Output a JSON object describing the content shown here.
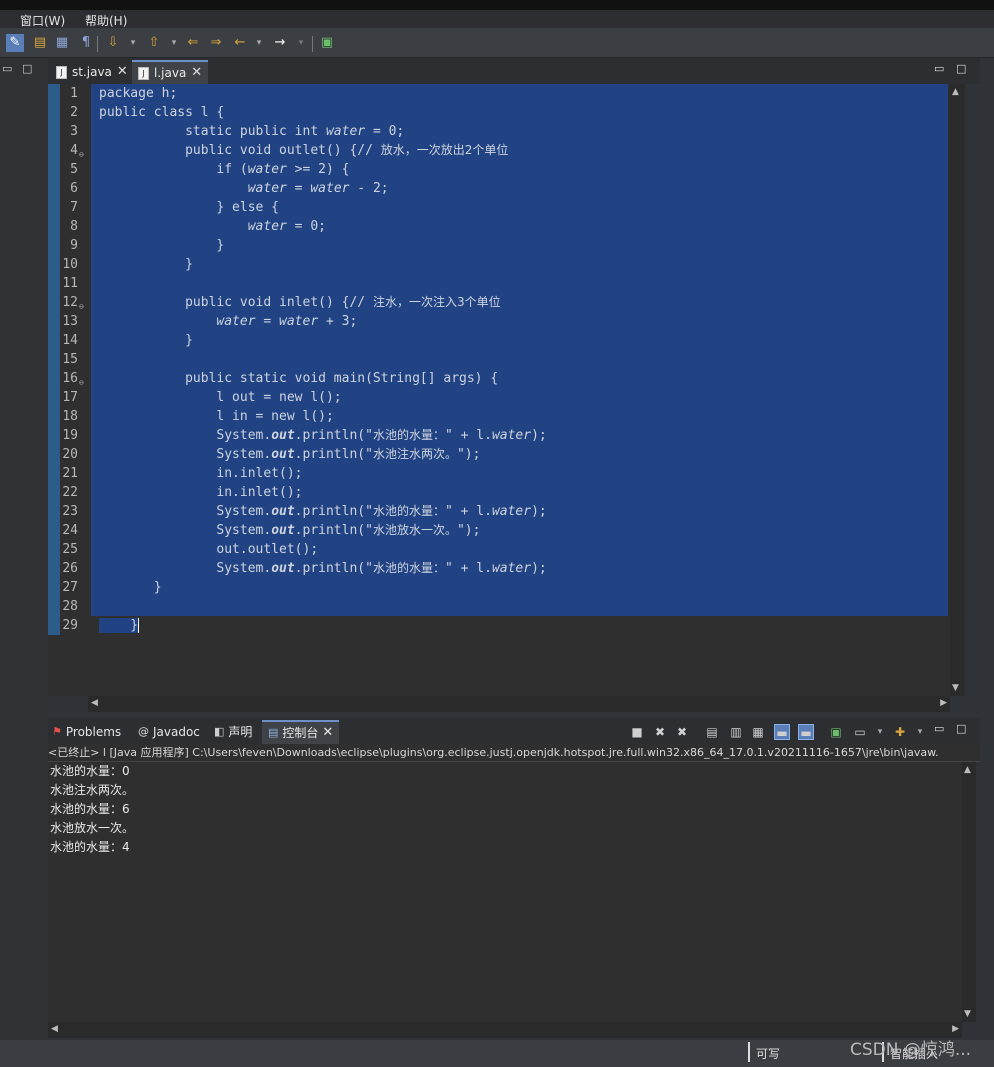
{
  "menubar": [
    "窗口(W)",
    "帮助(H)"
  ],
  "toolbar_icons": [
    "pencil-icon",
    "open-type-icon",
    "outline-icon",
    "paragraph-icon",
    "next-annotation-icon",
    "prev-annotation-icon",
    "last-edit-icon",
    "forward-history-icon",
    "back-icon",
    "forward-icon",
    "new-window-icon"
  ],
  "left_panel": {
    "minimize": "▭",
    "maximize": "□"
  },
  "editor": {
    "tabs": [
      {
        "label": "st.java"
      },
      {
        "label": "l.java",
        "active": true
      }
    ],
    "lines": [
      {
        "n": "1",
        "html": "package h;"
      },
      {
        "n": "2",
        "html": "public class l {"
      },
      {
        "n": "3",
        "html": "           static public int <span class=\"it\">water</span> = 0;"
      },
      {
        "n": "4",
        "fold": true,
        "html": "           public void outlet() {// <span class=\"zh\">放水，一次放出2个单位</span>"
      },
      {
        "n": "5",
        "html": "               if (<span class=\"it\">water</span> >= 2) {"
      },
      {
        "n": "6",
        "html": "                   <span class=\"it\">water</span> = <span class=\"it\">water</span> - 2;"
      },
      {
        "n": "7",
        "html": "               } else {"
      },
      {
        "n": "8",
        "html": "                   <span class=\"it\">water</span> = 0;"
      },
      {
        "n": "9",
        "html": "               }"
      },
      {
        "n": "10",
        "html": "           }"
      },
      {
        "n": "11",
        "html": ""
      },
      {
        "n": "12",
        "fold": true,
        "html": "           public void inlet() {// <span class=\"zh\">注水，一次注入3个单位</span>"
      },
      {
        "n": "13",
        "html": "               <span class=\"it\">water</span> = <span class=\"it\">water</span> + 3;"
      },
      {
        "n": "14",
        "html": "           }"
      },
      {
        "n": "15",
        "html": ""
      },
      {
        "n": "16",
        "fold": true,
        "html": "           public static void main(String[] args) {"
      },
      {
        "n": "17",
        "html": "               l out = new l();"
      },
      {
        "n": "18",
        "html": "               l in = new l();"
      },
      {
        "n": "19",
        "html": "               System.<span class=\"bi\">out</span>.println(\"<span class=\"zh\">水池的水量：</span>\" + l.<span class=\"it\">water</span>);"
      },
      {
        "n": "20",
        "html": "               System.<span class=\"bi\">out</span>.println(\"<span class=\"zh\">水池注水两次。</span>\");"
      },
      {
        "n": "21",
        "html": "               in.inlet();"
      },
      {
        "n": "22",
        "html": "               in.inlet();"
      },
      {
        "n": "23",
        "html": "               System.<span class=\"bi\">out</span>.println(\"<span class=\"zh\">水池的水量：</span>\" + l.<span class=\"it\">water</span>);"
      },
      {
        "n": "24",
        "html": "               System.<span class=\"bi\">out</span>.println(\"<span class=\"zh\">水池放水一次。</span>\");"
      },
      {
        "n": "25",
        "html": "               out.outlet();"
      },
      {
        "n": "26",
        "html": "               System.<span class=\"bi\">out</span>.println(\"<span class=\"zh\">水池的水量：</span>\" + l.<span class=\"it\">water</span>);"
      },
      {
        "n": "27",
        "html": "       }"
      },
      {
        "n": "28",
        "html": ""
      },
      {
        "n": "29",
        "html": "    }",
        "caret": true,
        "partial": true
      }
    ]
  },
  "console": {
    "tabs": [
      {
        "label": "Problems",
        "icon": "problems-icon"
      },
      {
        "label": "Javadoc",
        "icon": "at-icon"
      },
      {
        "label": "声明",
        "icon": "declaration-icon"
      },
      {
        "label": "控制台",
        "icon": "console-icon",
        "active": true
      }
    ],
    "header": "<已终止> l [Java 应用程序] C:\\Users\\feven\\Downloads\\eclipse\\plugins\\org.eclipse.justj.openjdk.hotspot.jre.full.win32.x86_64_17.0.1.v20211116-1657\\jre\\bin\\javaw.",
    "output": [
      "水池的水量：0",
      "水池注水两次。",
      "水池的水量：6",
      "水池放水一次。",
      "水池的水量：4"
    ]
  },
  "status": {
    "writable": "可写",
    "insert": "智能插入"
  },
  "watermark": "CSDN @惊鸿..."
}
